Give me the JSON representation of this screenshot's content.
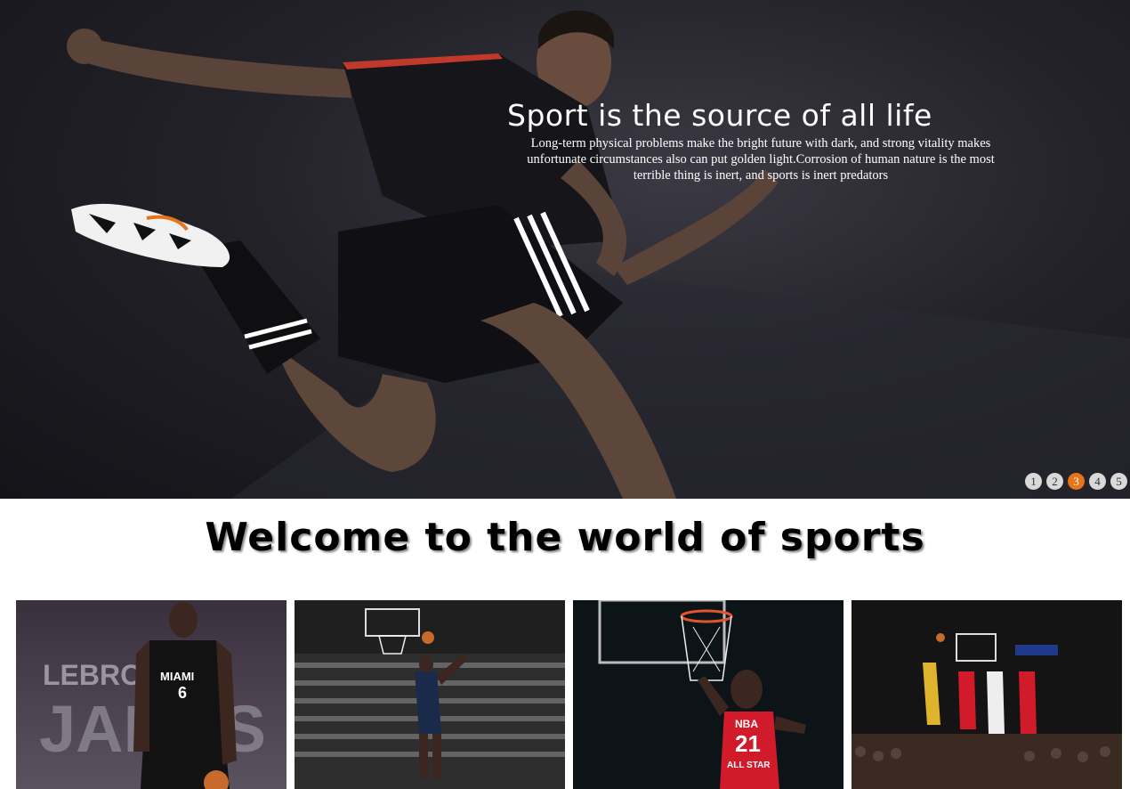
{
  "hero": {
    "title": "Sport is the source of all life",
    "description": "Long-term physical problems make the bright future with dark, and strong vitality makes unfortunate circumstances also can put golden light.Corrosion of human nature is the most terrible thing is inert, and sports is inert predators",
    "slides": [
      "1",
      "2",
      "3",
      "4",
      "5"
    ],
    "active_slide": 3,
    "accent_color": "#e8741a"
  },
  "welcome": {
    "heading": "Welcome to the world of sports"
  },
  "gallery": {
    "cards": [
      {
        "name": "lebron-james-card",
        "lines": [
          "LEBRON",
          "JAMES"
        ],
        "jersey_team": "MIAMI",
        "jersey_number": "6"
      },
      {
        "name": "dunk-arena-card"
      },
      {
        "name": "allstar-dunk-card",
        "jersey_team": "NBA",
        "jersey_number": "21",
        "jersey_sub": "ALL STAR"
      },
      {
        "name": "game-shot-card"
      }
    ]
  }
}
